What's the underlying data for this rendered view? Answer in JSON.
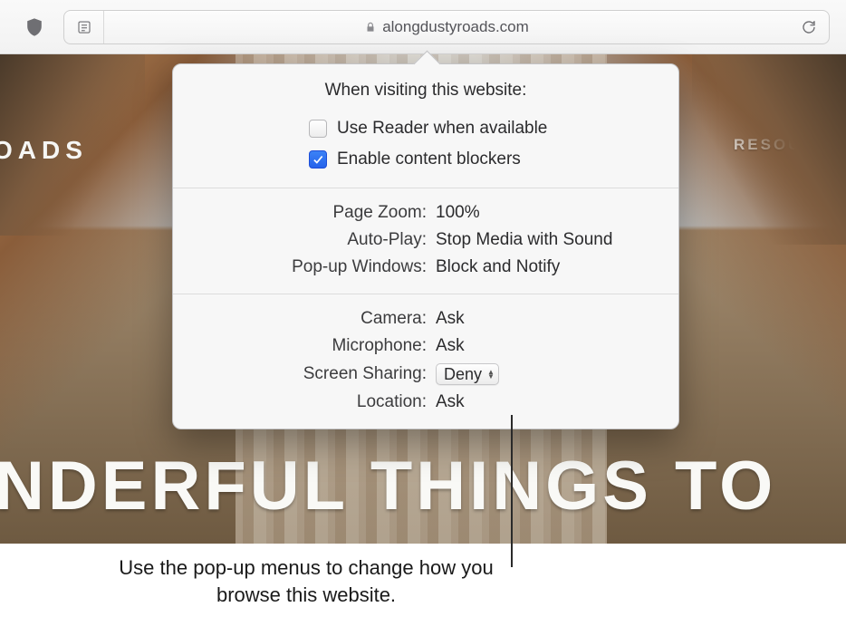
{
  "toolbar": {
    "domain": "alongdustyroads.com"
  },
  "hero": {
    "brand_fragment": "OADS",
    "resources_fragment": "RESOURC",
    "headline_fragment": "NDERFUL THINGS TO"
  },
  "popover": {
    "title": "When visiting this website:",
    "checkboxes": {
      "reader": {
        "label": "Use Reader when available",
        "checked": false
      },
      "blockers": {
        "label": "Enable content blockers",
        "checked": true
      }
    },
    "general": {
      "page_zoom": {
        "label": "Page Zoom:",
        "value": "100%"
      },
      "auto_play": {
        "label": "Auto-Play:",
        "value": "Stop Media with Sound"
      },
      "popups": {
        "label": "Pop-up Windows:",
        "value": "Block and Notify"
      }
    },
    "permissions": {
      "camera": {
        "label": "Camera:",
        "value": "Ask"
      },
      "microphone": {
        "label": "Microphone:",
        "value": "Ask"
      },
      "screen_sharing": {
        "label": "Screen Sharing:",
        "value": "Deny"
      },
      "location": {
        "label": "Location:",
        "value": "Ask"
      }
    }
  },
  "callout": "Use the pop-up menus to change how you browse this website."
}
